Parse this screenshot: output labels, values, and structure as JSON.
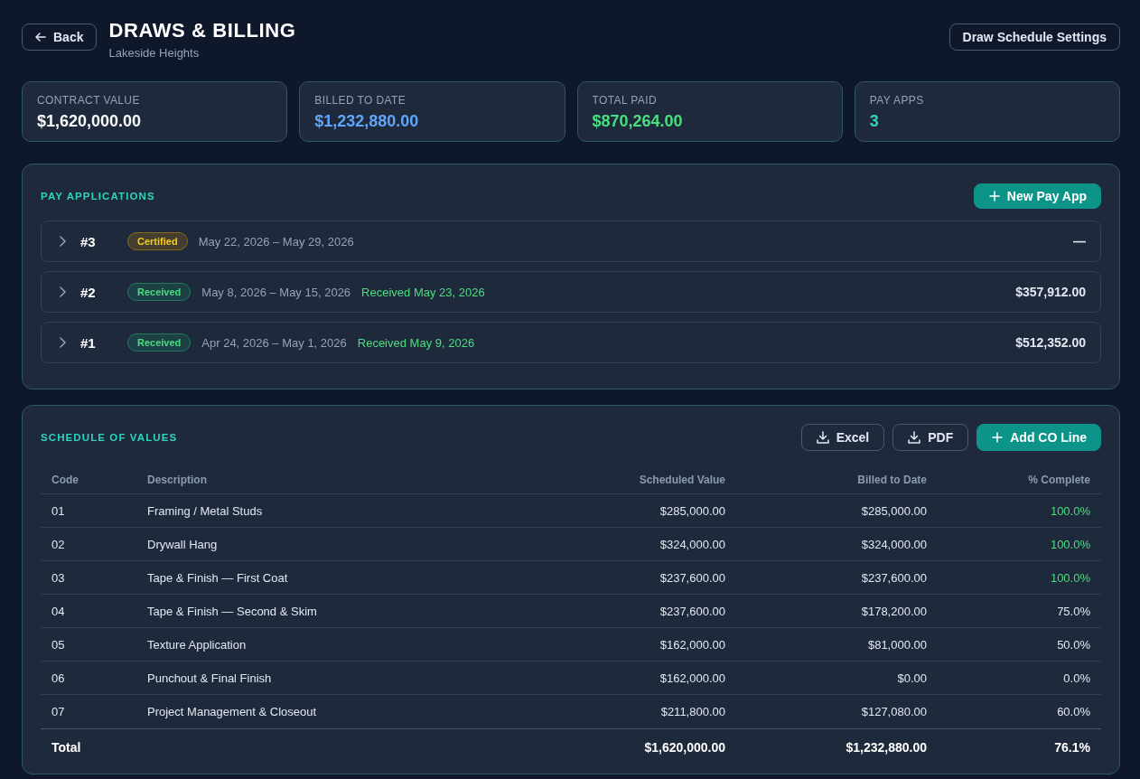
{
  "header": {
    "back_button": "Back",
    "title": "DRAWS & BILLING",
    "subtitle": "Lakeside Heights",
    "settings_button": "Draw Schedule Settings"
  },
  "stats": [
    {
      "label": "CONTRACT VALUE",
      "value": "$1,620,000.00",
      "color": "#f8fafc"
    },
    {
      "label": "BILLED TO DATE",
      "value": "$1,232,880.00",
      "color": "#60a5fa"
    },
    {
      "label": "TOTAL PAID",
      "value": "$870,264.00",
      "color": "#4ade80"
    },
    {
      "label": "PAY APPS",
      "value": "3",
      "color": "#2dd4bf"
    }
  ],
  "pay_applications": {
    "title": "PAY APPLICATIONS",
    "new_button": "New Pay App",
    "items": [
      {
        "number": "#3",
        "expanded": false,
        "status": {
          "label": "Certified",
          "kind": "certified"
        },
        "period": "May 22, 2026 – May 29, 2026",
        "amount": "—"
      },
      {
        "number": "#2",
        "expanded": false,
        "status": {
          "label": "Received",
          "kind": "received"
        },
        "period": "May 8, 2026 – May 15, 2026",
        "received_note": "Received May 23, 2026",
        "amount": "$357,912.00"
      },
      {
        "number": "#1",
        "expanded": false,
        "status": {
          "label": "Received",
          "kind": "received"
        },
        "period": "Apr 24, 2026 – May 1, 2026",
        "received_note": "Received May 9, 2026",
        "amount": "$512,352.00"
      }
    ]
  },
  "schedule_of_values": {
    "title": "SCHEDULE OF VALUES",
    "buttons": [
      {
        "label": "Excel",
        "kind": "download"
      },
      {
        "label": "PDF",
        "kind": "download"
      },
      {
        "label": "Add CO Line",
        "kind": "add"
      }
    ],
    "table": {
      "columns": [
        "Code",
        "Description",
        "Scheduled Value",
        "Billed to Date",
        "% Complete"
      ],
      "rows": [
        {
          "code": "01",
          "description": "Framing / Metal Studs",
          "scheduled_value": "$285,000.00",
          "billed_to_date": "$285,000.00",
          "percent_complete": "100.0%",
          "complete": true
        },
        {
          "code": "02",
          "description": "Drywall Hang",
          "scheduled_value": "$324,000.00",
          "billed_to_date": "$324,000.00",
          "percent_complete": "100.0%",
          "complete": true
        },
        {
          "code": "03",
          "description": "Tape & Finish — First Coat",
          "scheduled_value": "$237,600.00",
          "billed_to_date": "$237,600.00",
          "percent_complete": "100.0%",
          "complete": true
        },
        {
          "code": "04",
          "description": "Tape & Finish — Second & Skim",
          "scheduled_value": "$237,600.00",
          "billed_to_date": "$178,200.00",
          "percent_complete": "75.0%",
          "complete": false
        },
        {
          "code": "05",
          "description": "Texture Application",
          "scheduled_value": "$162,000.00",
          "billed_to_date": "$81,000.00",
          "percent_complete": "50.0%",
          "complete": false
        },
        {
          "code": "06",
          "description": "Punchout & Final Finish",
          "scheduled_value": "$162,000.00",
          "billed_to_date": "$0.00",
          "percent_complete": "0.0%",
          "complete": false
        },
        {
          "code": "07",
          "description": "Project Management & Closeout",
          "scheduled_value": "$211,800.00",
          "billed_to_date": "$127,080.00",
          "percent_complete": "60.0%",
          "complete": false
        }
      ],
      "total": {
        "label": "Total",
        "scheduled_value": "$1,620,000.00",
        "billed_to_date": "$1,232,880.00",
        "percent_complete": "76.1%"
      }
    }
  }
}
